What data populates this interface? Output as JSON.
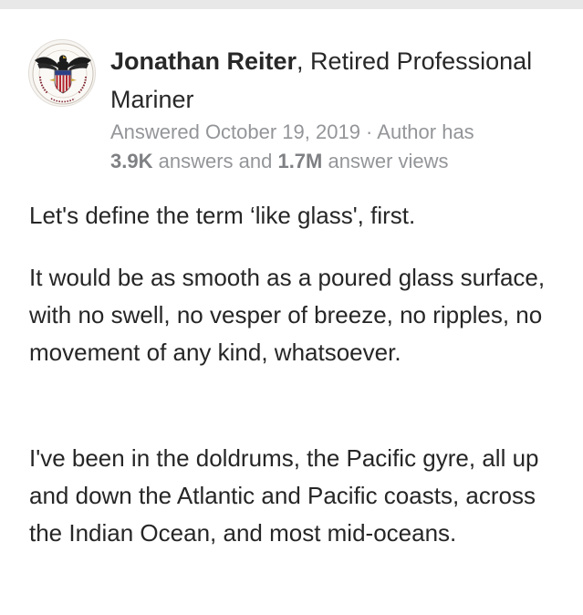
{
  "author": {
    "name": "Jonathan Reiter",
    "credential": ", Retired Professional Mariner",
    "avatar_icon": "merchant-marine-seal-icon"
  },
  "meta": {
    "answered_prefix": "Answered October 19, 2019 · Author has",
    "answers_count": "3.9K",
    "answers_label": " answers and ",
    "views_count": "1.7M",
    "views_label": " answer views"
  },
  "content": {
    "paragraphs": [
      "Let's define the term ‘like glass', first.",
      "It would be as smooth as a poured glass surface, with no swell, no vesper of breeze, no ripples, no movement of any kind, whatsoever.",
      "I've been in the doldrums, the Pacific gyre, all up and down the Atlantic and Pacific coasts, across the Indian Ocean, and most mid-oceans."
    ]
  },
  "colors": {
    "name_text": "#282828",
    "meta_text": "#939598",
    "body_text": "#262626",
    "top_strip": "#e8e8e8"
  }
}
